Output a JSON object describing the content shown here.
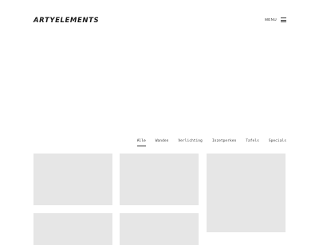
{
  "header": {
    "logo": "ARTYELEMENTS",
    "menu_label": "MENU"
  },
  "filters": [
    {
      "label": "Alle",
      "active": true
    },
    {
      "label": "Wanden",
      "active": false
    },
    {
      "label": "Verlichting",
      "active": false
    },
    {
      "label": "Inzetperken",
      "active": false
    },
    {
      "label": "Tafels",
      "active": false
    },
    {
      "label": "Specials",
      "active": false
    }
  ],
  "colors": {
    "card_background": "#e6e6e6",
    "text": "#222222"
  }
}
